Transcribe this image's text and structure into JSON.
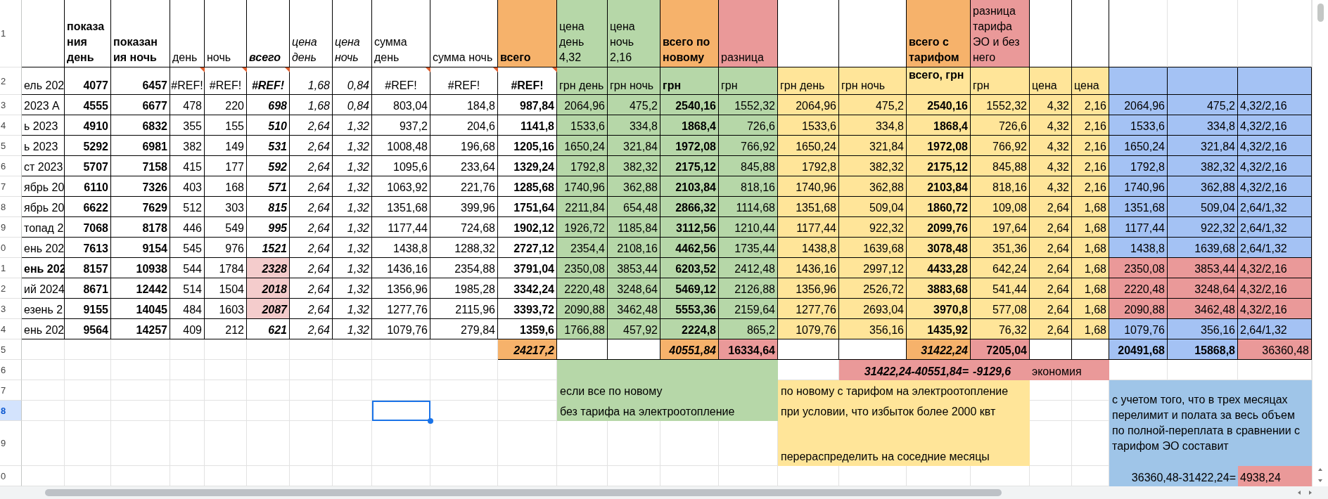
{
  "row_headers": [
    {
      "label": "1",
      "selected": false
    },
    {
      "label": "2",
      "selected": false
    },
    {
      "label": "3",
      "selected": false
    },
    {
      "label": "4",
      "selected": false
    },
    {
      "label": "5",
      "selected": false
    },
    {
      "label": "6",
      "selected": false
    },
    {
      "label": "7",
      "selected": false
    },
    {
      "label": "8",
      "selected": false
    },
    {
      "label": "9",
      "selected": false
    },
    {
      "label": "0",
      "selected": false
    },
    {
      "label": "1",
      "selected": false
    },
    {
      "label": "2",
      "selected": false
    },
    {
      "label": "3",
      "selected": false
    },
    {
      "label": "4",
      "selected": false
    },
    {
      "label": "5",
      "selected": false
    },
    {
      "label": "6",
      "selected": false
    },
    {
      "label": "7",
      "selected": false
    },
    {
      "label": "8",
      "selected": true
    },
    {
      "label": "9",
      "selected": false
    },
    {
      "label": "0",
      "selected": false
    }
  ],
  "header_row": [
    {
      "kind": "blank"
    },
    {
      "kind": "label",
      "text": "показания день"
    },
    {
      "kind": "label",
      "text": "показания ночь"
    },
    {
      "kind": "label",
      "text": "день"
    },
    {
      "kind": "label",
      "text": "ночь"
    },
    {
      "kind": "label",
      "text": "всего"
    },
    {
      "kind": "label",
      "text": "цена день"
    },
    {
      "kind": "label",
      "text": "цена ночь"
    },
    {
      "kind": "label",
      "text": "сумма день"
    },
    {
      "kind": "label",
      "text": "сумма ночь"
    },
    {
      "kind": "label",
      "text": "всего"
    },
    {
      "kind": "label",
      "text": "цена день 4,32"
    },
    {
      "kind": "label",
      "text": "цена ночь 2,16"
    },
    {
      "kind": "label",
      "text": "всего по новому"
    },
    {
      "kind": "label",
      "text": "разница"
    },
    {
      "kind": "blank"
    },
    {
      "kind": "blank"
    },
    {
      "kind": "label",
      "text": "всего с тарифом"
    },
    {
      "kind": "label",
      "text": "разница тарифа ЭО и без него"
    },
    {
      "kind": "blank"
    },
    {
      "kind": "blank"
    },
    {
      "kind": "blank"
    },
    {
      "kind": "blank"
    },
    {
      "kind": "blank"
    }
  ],
  "units_row": {
    "has_notes": true,
    "cells": [
      "ель 202",
      "4077",
      "6457",
      "#REF!",
      "#REF!",
      "#REF!",
      "1,68",
      "0,84",
      "#REF!",
      "#REF!",
      "#REF!",
      "грн день",
      "грн ночь",
      "грн",
      "грн",
      "грн день",
      "грн ночь",
      "всего, грн",
      "грн",
      "цена",
      "цена"
    ]
  },
  "rows": [
    {
      "flagged": false,
      "emphasized": false,
      "cells": [
        "2023 А",
        "4555",
        "6677",
        "478",
        "220",
        "698",
        "1,68",
        "0,84",
        "803,04",
        "184,8",
        "987,84",
        "2064,96",
        "475,2",
        "2540,16",
        "1552,32",
        "2064,96",
        "475,2",
        "2540,16",
        "1552,32",
        "4,32",
        "2,16",
        "2064,96",
        "475,2",
        "4,32/2,16"
      ]
    },
    {
      "flagged": false,
      "emphasized": false,
      "cells": [
        "ь 2023",
        "4910",
        "6832",
        "355",
        "155",
        "510",
        "2,64",
        "1,32",
        "937,2",
        "204,6",
        "1141,8",
        "1533,6",
        "334,8",
        "1868,4",
        "726,6",
        "1533,6",
        "334,8",
        "1868,4",
        "726,6",
        "4,32",
        "2,16",
        "1533,6",
        "334,8",
        "4,32/2,16"
      ]
    },
    {
      "flagged": false,
      "emphasized": false,
      "cells": [
        "ь 2023",
        "5292",
        "6981",
        "382",
        "149",
        "531",
        "2,64",
        "1,32",
        "1008,48",
        "196,68",
        "1205,16",
        "1650,24",
        "321,84",
        "1972,08",
        "766,92",
        "1650,24",
        "321,84",
        "1972,08",
        "766,92",
        "4,32",
        "2,16",
        "1650,24",
        "321,84",
        "4,32/2,16"
      ]
    },
    {
      "flagged": false,
      "emphasized": false,
      "cells": [
        "ст 2023",
        "5707",
        "7158",
        "415",
        "177",
        "592",
        "2,64",
        "1,32",
        "1095,6",
        "233,64",
        "1329,24",
        "1792,8",
        "382,32",
        "2175,12",
        "845,88",
        "1792,8",
        "382,32",
        "2175,12",
        "845,88",
        "4,32",
        "2,16",
        "1792,8",
        "382,32",
        "4,32/2,16"
      ]
    },
    {
      "flagged": false,
      "emphasized": false,
      "cells": [
        "ябрь 20",
        "6110",
        "7326",
        "403",
        "168",
        "571",
        "2,64",
        "1,32",
        "1063,92",
        "221,76",
        "1285,68",
        "1740,96",
        "362,88",
        "2103,84",
        "818,16",
        "1740,96",
        "362,88",
        "2103,84",
        "818,16",
        "4,32",
        "2,16",
        "1740,96",
        "362,88",
        "4,32/2,16"
      ]
    },
    {
      "flagged": false,
      "emphasized": false,
      "cells": [
        "ябрь 20",
        "6622",
        "7629",
        "512",
        "303",
        "815",
        "2,64",
        "1,32",
        "1351,68",
        "399,96",
        "1751,64",
        "2211,84",
        "654,48",
        "2866,32",
        "1114,68",
        "1351,68",
        "509,04",
        "1860,72",
        "109,08",
        "2,64",
        "1,68",
        "1351,68",
        "509,04",
        "2,64/1,32"
      ]
    },
    {
      "flagged": false,
      "emphasized": false,
      "cells": [
        "топад 2",
        "7068",
        "8178",
        "446",
        "549",
        "995",
        "2,64",
        "1,32",
        "1177,44",
        "724,68",
        "1902,12",
        "1926,72",
        "1185,84",
        "3112,56",
        "1210,44",
        "1177,44",
        "922,32",
        "2099,76",
        "197,64",
        "2,64",
        "1,68",
        "1177,44",
        "922,32",
        "2,64/1,32"
      ]
    },
    {
      "flagged": false,
      "emphasized": false,
      "cells": [
        "ень 202",
        "7613",
        "9154",
        "545",
        "976",
        "1521",
        "2,64",
        "1,32",
        "1438,8",
        "1288,32",
        "2727,12",
        "2354,4",
        "2108,16",
        "4462,56",
        "1735,44",
        "1438,8",
        "1639,68",
        "3078,48",
        "351,36",
        "2,64",
        "1,68",
        "1438,8",
        "1639,68",
        "2,64/1,32"
      ]
    },
    {
      "flagged": true,
      "emphasized": true,
      "cells": [
        "ень 202",
        "8157",
        "10938",
        "544",
        "1784",
        "2328",
        "2,64",
        "1,32",
        "1436,16",
        "2354,88",
        "3791,04",
        "2350,08",
        "3853,44",
        "6203,52",
        "2412,48",
        "1436,16",
        "2997,12",
        "4433,28",
        "642,24",
        "2,64",
        "1,68",
        "2350,08",
        "3853,44",
        "4,32/2,16"
      ]
    },
    {
      "flagged": true,
      "emphasized": false,
      "cells": [
        "ий 2024",
        "8671",
        "12442",
        "514",
        "1504",
        "2018",
        "2,64",
        "1,32",
        "1356,96",
        "1985,28",
        "3342,24",
        "2220,48",
        "3248,64",
        "5469,12",
        "2126,88",
        "1356,96",
        "2526,72",
        "3883,68",
        "541,44",
        "2,64",
        "1,68",
        "2220,48",
        "3248,64",
        "4,32/2,16"
      ]
    },
    {
      "flagged": true,
      "emphasized": false,
      "cells": [
        "езень 2",
        "9155",
        "14045",
        "484",
        "1603",
        "2087",
        "2,64",
        "1,32",
        "1277,76",
        "2115,96",
        "3393,72",
        "2090,88",
        "3462,48",
        "5553,36",
        "2159,64",
        "1277,76",
        "2693,04",
        "3970,8",
        "577,08",
        "2,64",
        "1,68",
        "2090,88",
        "3462,48",
        "4,32/2,16"
      ]
    },
    {
      "flagged": false,
      "emphasized": false,
      "cells": [
        "ень 202",
        "9564",
        "14257",
        "409",
        "212",
        "621",
        "2,64",
        "1,32",
        "1079,76",
        "279,84",
        "1359,6",
        "1766,88",
        "457,92",
        "2224,8",
        "865,2",
        "1079,76",
        "356,16",
        "1435,92",
        "76,32",
        "2,64",
        "1,68",
        "1079,76",
        "356,16",
        "2,64/1,32"
      ]
    }
  ],
  "totals": {
    "sum_all": "24217,2",
    "sum_new": "40551,84",
    "diff_new": "16334,64",
    "sum_tariff": "31422,24",
    "diff_tariff": "7205,04",
    "blue_day": "20491,68",
    "blue_night": "15868,8",
    "blue_total": "36360,48"
  },
  "savings": {
    "formula": "31422,24-40551,84=",
    "result": "-9129,6",
    "label": "экономия"
  },
  "green_notes": [
    "если все по новому",
    "без тарифа на электроотопление"
  ],
  "yellow_notes": [
    "по новому с тарифом на электроотопление",
    "при условии, что избыток более 2000 квт",
    "перераспределить на соседние месяцы"
  ],
  "overpay": {
    "note": "с учетом того, что в трех месяцах перелимит и полата за весь объем по полной-переплата в сравнении с тарифом ЭО составит",
    "formula": "36360,48-31422,24=",
    "result": "4938,24"
  }
}
